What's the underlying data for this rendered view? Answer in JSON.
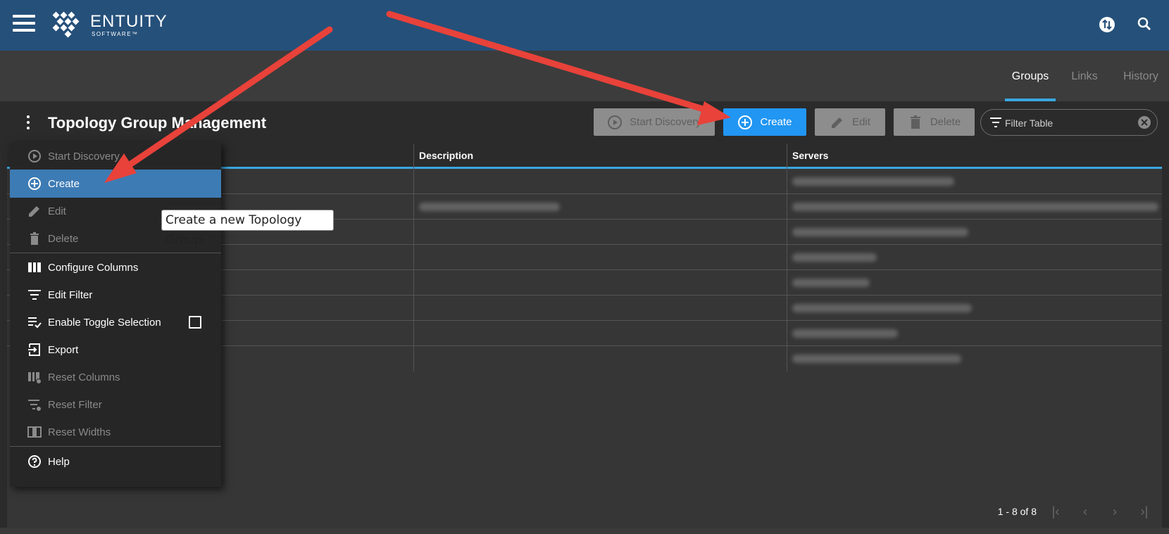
{
  "header": {
    "logo_name": "ENTUITY",
    "logo_sub": "SOFTWARE™"
  },
  "tabs": [
    {
      "label": "Groups",
      "active": true
    },
    {
      "label": "Links",
      "active": false
    },
    {
      "label": "History",
      "active": false
    }
  ],
  "panel": {
    "title": "Topology Group Management"
  },
  "toolbar": {
    "start_discovery": "Start Discovery",
    "create": "Create",
    "edit": "Edit",
    "delete": "Delete",
    "filter_placeholder": "Filter Table"
  },
  "table": {
    "columns": [
      "",
      "Description",
      "Servers"
    ],
    "row_count": 8
  },
  "pager": {
    "range": "1 - 8 of 8"
  },
  "menu": {
    "items": [
      {
        "label": "Start Discovery",
        "icon": "play-circle-icon",
        "enabled": false
      },
      {
        "label": "Create",
        "icon": "add-circle-icon",
        "enabled": true,
        "selected": true
      },
      {
        "label": "Edit",
        "icon": "pencil-icon",
        "enabled": false
      },
      {
        "label": "Delete",
        "icon": "trash-icon",
        "enabled": false
      },
      {
        "label": "Configure Columns",
        "icon": "columns-icon",
        "enabled": true
      },
      {
        "label": "Edit Filter",
        "icon": "filter-icon",
        "enabled": true
      },
      {
        "label": "Enable Toggle Selection",
        "icon": "checklist-icon",
        "enabled": true,
        "checked": false
      },
      {
        "label": "Export",
        "icon": "export-icon",
        "enabled": true
      },
      {
        "label": "Reset Columns",
        "icon": "reset-columns-icon",
        "enabled": false
      },
      {
        "label": "Reset Filter",
        "icon": "reset-filter-icon",
        "enabled": false
      },
      {
        "label": "Reset Widths",
        "icon": "reset-widths-icon",
        "enabled": false
      },
      {
        "label": "Help",
        "icon": "help-icon",
        "enabled": true
      }
    ]
  },
  "tooltip": {
    "text": "Create a new Topology Group"
  },
  "colors": {
    "header": "#25507a",
    "accent": "#2196f3",
    "tab_underline": "#3aa7e0",
    "menu_selected": "#3d7bb4",
    "annotation_arrow": "#e8423a"
  }
}
